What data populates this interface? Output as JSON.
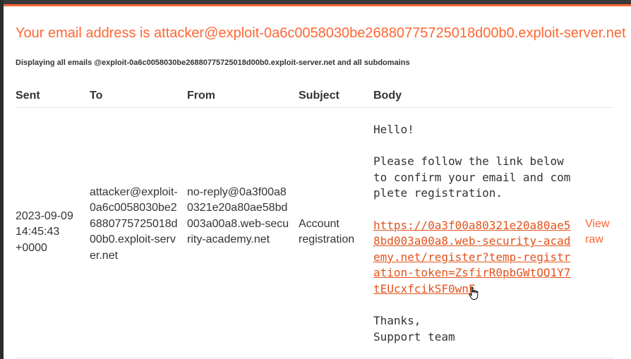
{
  "header": {
    "title": "Your email address is attacker@exploit-0a6c0058030be26880775725018d00b0.exploit-server.net",
    "subtitle": "Displaying all emails @exploit-0a6c0058030be26880775725018d00b0.exploit-server.net and all subdomains"
  },
  "table": {
    "columns": [
      "Sent",
      "To",
      "From",
      "Subject",
      "Body"
    ],
    "rows": [
      {
        "sent": "2023-09-09 14:45:43 +0000",
        "to": "attacker@exploit-0a6c0058030be26880775725018d00b0.exploit-server.net",
        "from": "no-reply@0a3f00a80321e20a80ae58bd003a00a8.web-security-academy.net",
        "subject": "Account registration",
        "body_greeting": "Hello!",
        "body_instructions": "Please follow the link below to confirm your email and complete registration.",
        "body_link": "https://0a3f00a80321e20a80ae58bd003a00a8.web-security-academy.net/register?temp-registration-token=ZsfirR0pbGWtQQ1Y7tEUcxfcikSF0wnF",
        "body_thanks": "Thanks,",
        "body_signature": "Support team",
        "view_raw": "View raw"
      }
    ]
  },
  "colors": {
    "accent": "#ff6633",
    "link": "#e2531c",
    "text": "#333333"
  }
}
